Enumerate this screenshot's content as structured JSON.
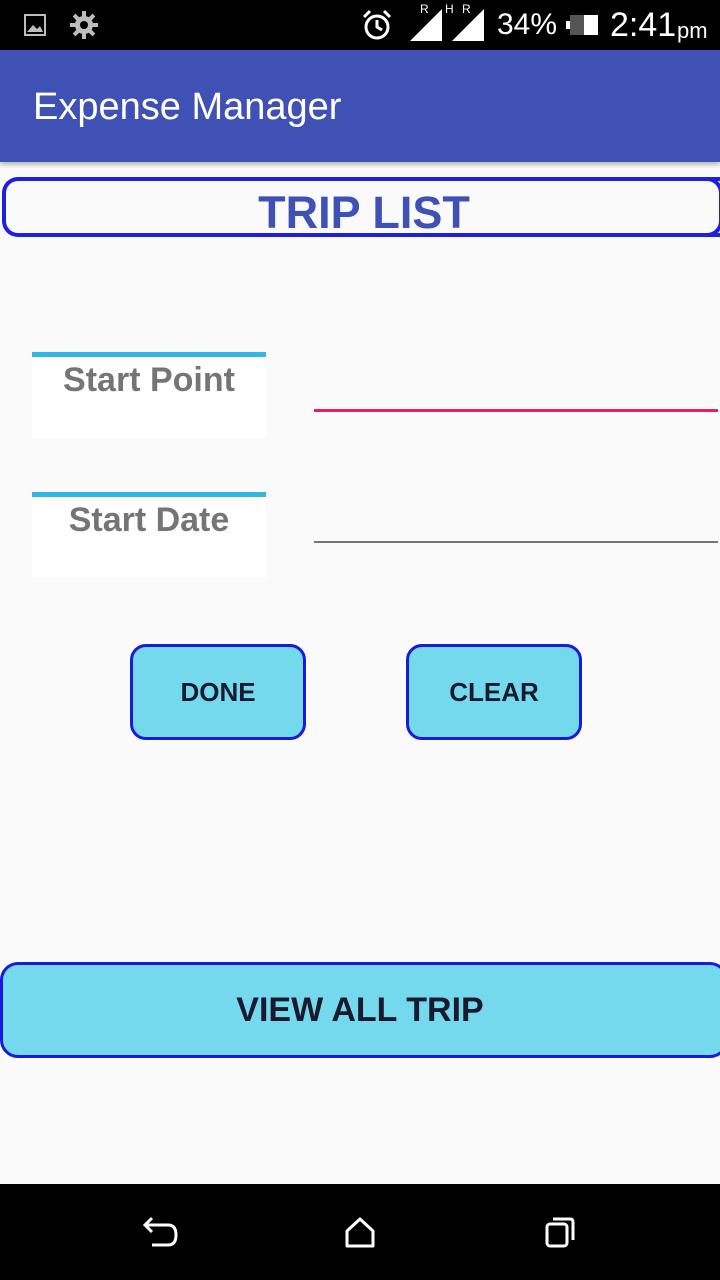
{
  "status_bar": {
    "signal_labels": [
      "R",
      "H",
      "R"
    ],
    "battery_percent": "34%",
    "time": "2:41",
    "ampm": "pm",
    "icons": [
      "image-icon",
      "gear-icon",
      "alarm-icon",
      "signal-icon",
      "signal-icon",
      "battery-icon"
    ]
  },
  "app_bar": {
    "title": "Expense Manager"
  },
  "heading": "TRIP LIST",
  "form": {
    "start_point_label": "Start Point",
    "start_point_value": "",
    "start_date_label": "Start Date",
    "start_date_value": ""
  },
  "buttons": {
    "done": "DONE",
    "clear": "CLEAR",
    "view_all": "VIEW ALL TRIP"
  },
  "nav_bar": {
    "icons": [
      "back-icon",
      "home-icon",
      "recents-icon"
    ]
  },
  "colors": {
    "primary": "#3f51b5",
    "accent": "#e91e63",
    "button_fill": "#74d9ec",
    "button_border": "#1a1adb",
    "label_top_border": "#33b5e5"
  }
}
